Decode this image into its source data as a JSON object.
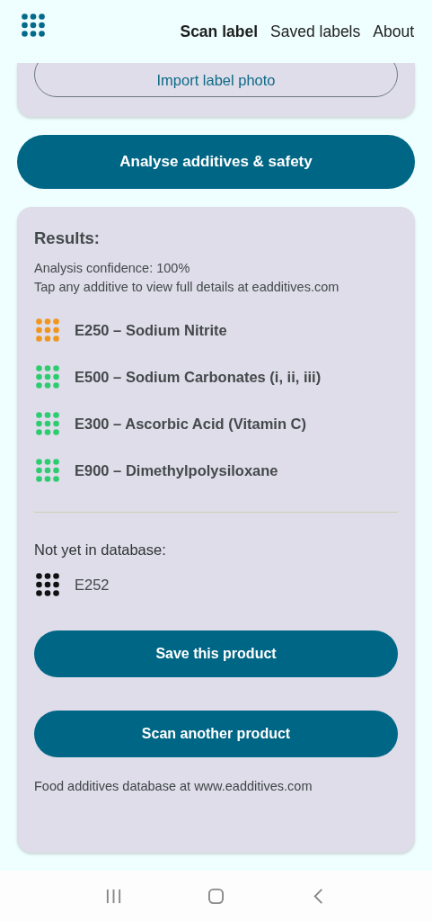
{
  "tabs": [
    {
      "label": "Scan label",
      "selected": true
    },
    {
      "label": "Saved labels",
      "selected": false
    },
    {
      "label": "About",
      "selected": false
    }
  ],
  "import_button": "Import label photo",
  "analyse_button": "Analyse additives & safety",
  "results": {
    "title": "Results:",
    "confidence": "Analysis confidence: 100%",
    "hint": "Tap any additive to view full details at eadditives.com",
    "additives": [
      {
        "label": "E250 – Sodium Nitrite",
        "color": "#f0961e"
      },
      {
        "label": "E500 – Sodium Carbonates (i, ii, iii)",
        "color": "#2ecc71"
      },
      {
        "label": "E300 – Ascorbic Acid (Vitamin C)",
        "color": "#2ecc71"
      },
      {
        "label": "E900 – Dimethylpolysiloxane",
        "color": "#2ecc71"
      }
    ],
    "unknown_title": "Not yet in database:",
    "unknown": [
      {
        "label": "E252",
        "color": "#111111"
      }
    ],
    "save_button": "Save this product",
    "scan_button": "Scan another product",
    "footer": "Food additives database at www.eadditives.com"
  }
}
